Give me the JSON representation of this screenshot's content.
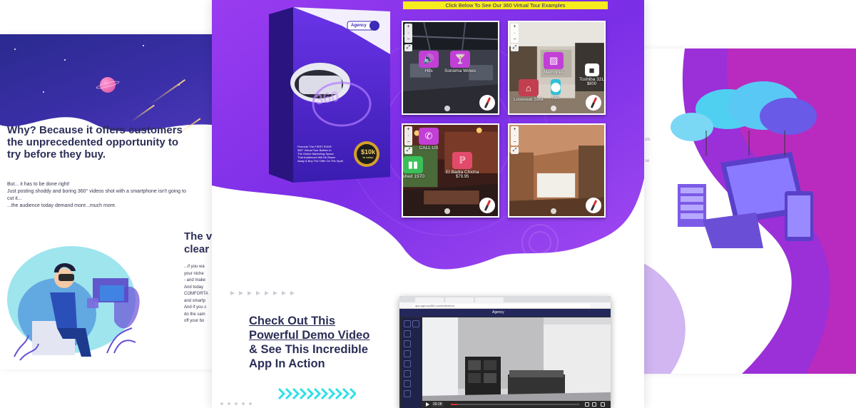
{
  "left_panel": {
    "heading": "Why? Because it offers customers the unprecedented opportunity to try before they buy.",
    "body": [
      "But... it has to be done right!",
      "Just posting shoddy and boring 360° videos shot with a smartphone isn't going to cut it...",
      "...the audience today demand more...much more."
    ],
    "subhead_fragment": [
      "The v",
      "clear"
    ],
    "cut_text": [
      "...if you wa",
      "your niche",
      "- and make",
      "And today",
      "COMFORTA",
      "and smartp",
      "And if you c",
      "do the sam",
      "off your bo"
    ]
  },
  "center_panel": {
    "banner_text": "Click Below To See Our 360 Virtual Tour Examples",
    "product_box": {
      "brand": "Agency",
      "badge_main": "$10k",
      "badge_sub": "in value",
      "box_text": [
        "Promote The FIRST EVER",
        "360° Virtual Tour Builder In",
        "The Online Marketing Space",
        "That Audiences Will Be Blown",
        "Away & Buy The Offer On The Spot!"
      ],
      "cover_number": "360"
    },
    "tour_examples": [
      {
        "hotspots": [
          {
            "label": "Hits",
            "icon": "speaker-icon"
          },
          {
            "label": "Sonoma Wines",
            "icon": "glass-icon"
          }
        ]
      },
      {
        "hotspots": [
          {
            "label": "Memories",
            "icon": "image-icon"
          },
          {
            "label": "Toshiba 32L",
            "price": "$800",
            "icon": "video-icon"
          },
          {
            "label": "Loveseat Sofa",
            "icon": "home-icon"
          },
          {
            "label": "NG",
            "icon": "pin-icon"
          }
        ]
      },
      {
        "hotspots": [
          {
            "label": "CALL US",
            "icon": "phone-icon"
          },
          {
            "label": "El Badia Chicha",
            "price": "$79.95",
            "icon": "product-icon"
          },
          {
            "label": "ished 1970",
            "icon": "battery-icon"
          }
        ]
      },
      {
        "hotspots": []
      }
    ],
    "demo_heading": {
      "line1": "Check Out This",
      "line2": "Powerful Demo Video",
      "line3": "& See This Incredible",
      "line4": "App In Action"
    },
    "video": {
      "url": "app.agency360.com/editor/tour",
      "app_logo": "Agency",
      "time": "09:28",
      "progress": 0.05
    }
  },
  "right_panel": {
    "cut_text": [
      "ols",
      "se"
    ]
  },
  "colors": {
    "brand_purple": "#7b2ff2",
    "deep_purple": "#3a1c9e",
    "magenta": "#c21c9e",
    "banner_yellow": "#f7ec1e",
    "heading_navy": "#2b2f57",
    "chevron_cyan": "#2ee0e6"
  }
}
